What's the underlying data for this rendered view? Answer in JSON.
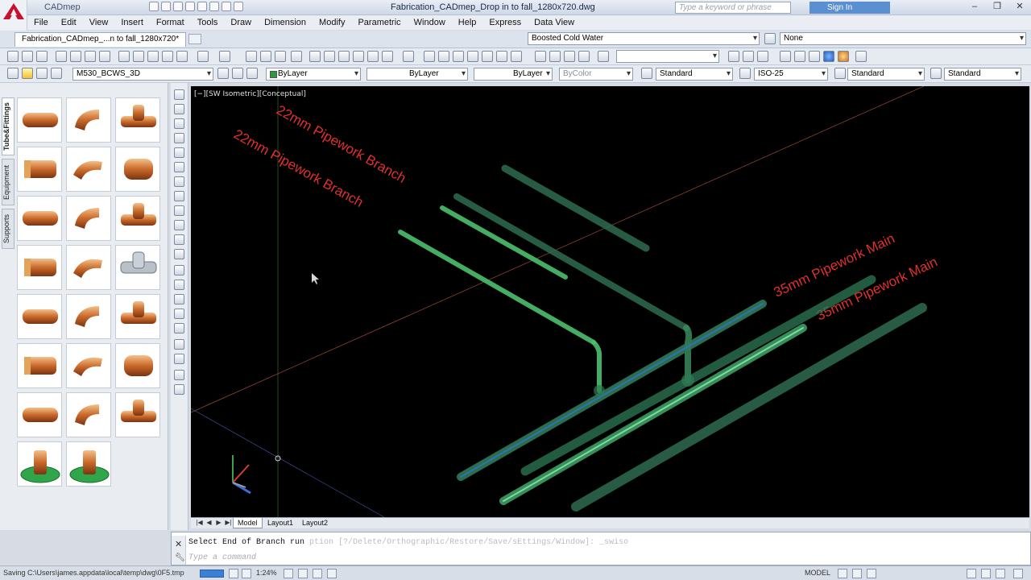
{
  "app": {
    "name": "CADmep",
    "window_title": "Fabrication_CADmep_Drop in to fall_1280x720.dwg",
    "search_placeholder": "Type a keyword or phrase",
    "sign_in": "Sign In",
    "window_controls": [
      "–",
      "❐",
      "✕"
    ]
  },
  "menu": [
    "File",
    "Edit",
    "View",
    "Insert",
    "Format",
    "Tools",
    "Draw",
    "Dimension",
    "Modify",
    "Parametric",
    "Window",
    "Help",
    "Express",
    "Data View"
  ],
  "doc_tab": {
    "label": "Fabrication_CADmep_...n to fall_1280x720*"
  },
  "service_combo": {
    "value": "Boosted Cold Water"
  },
  "service_filter": {
    "value": "None"
  },
  "layer_toolbar": {
    "layer": "M530_BCWS_3D",
    "color": "ByLayer",
    "linetype": "ByLayer",
    "lineweight": "ByLayer",
    "plotstyle": "ByColor",
    "text_style": "Standard",
    "dim_style": "ISO-25",
    "table_style": "Standard",
    "mleader_style": "Standard"
  },
  "palette": {
    "tabs": [
      "Tube&Fittings",
      "Equipment",
      "Supports"
    ],
    "active_tab": "Tube&Fittings",
    "items": [
      {
        "icon": "copper-tube-icon"
      },
      {
        "icon": "elbow-90-icon"
      },
      {
        "icon": "elbow-45-icon"
      },
      {
        "icon": "street-elbow-icon"
      },
      {
        "icon": "bend-icon"
      },
      {
        "icon": "obtuse-elbow-icon"
      },
      {
        "icon": "straight-coupling-icon"
      },
      {
        "icon": "equal-tee-icon"
      },
      {
        "icon": "reducing-tee-icon"
      },
      {
        "icon": "branch-tee-icon"
      },
      {
        "icon": "short-tee-icon"
      },
      {
        "icon": "stainless-tee-icon"
      },
      {
        "icon": "male-adaptor-icon"
      },
      {
        "icon": "brass-adaptor-icon"
      },
      {
        "icon": "threaded-adaptor-icon"
      },
      {
        "icon": "union-icon"
      },
      {
        "icon": "female-union-icon"
      },
      {
        "icon": "reducer-icon"
      },
      {
        "icon": "tube-end-icon"
      },
      {
        "icon": "end-cap-icon"
      },
      {
        "icon": "spigot-icon"
      },
      {
        "icon": "flange-adaptor-icon"
      },
      {
        "icon": "flange-spigot-icon"
      }
    ]
  },
  "viewport": {
    "label": "[−][SW Isometric][Conceptual]",
    "annotations": [
      {
        "text": "22mm Pipework Branch"
      },
      {
        "text": "22mm Pipework Branch"
      },
      {
        "text": "35mm Pipework Main"
      },
      {
        "text": "35mm Pipework Main"
      }
    ],
    "annotation_color": "#e0302c",
    "pipe_color": "#3fae5a"
  },
  "layout_tabs": [
    "Model",
    "Layout1",
    "Layout2"
  ],
  "command": {
    "history": "Select End of Branch run",
    "history_dim": "ption [?/Delete/Orthographic/Restore/Save/sEttings/Window]: _swiso",
    "prompt": "Type a command"
  },
  "status": {
    "text": "Saving C:\\Users\\james.appdata\\local\\temp\\dwg\\0F5.tmp",
    "zoom": "1:24%",
    "model": "MODEL"
  }
}
